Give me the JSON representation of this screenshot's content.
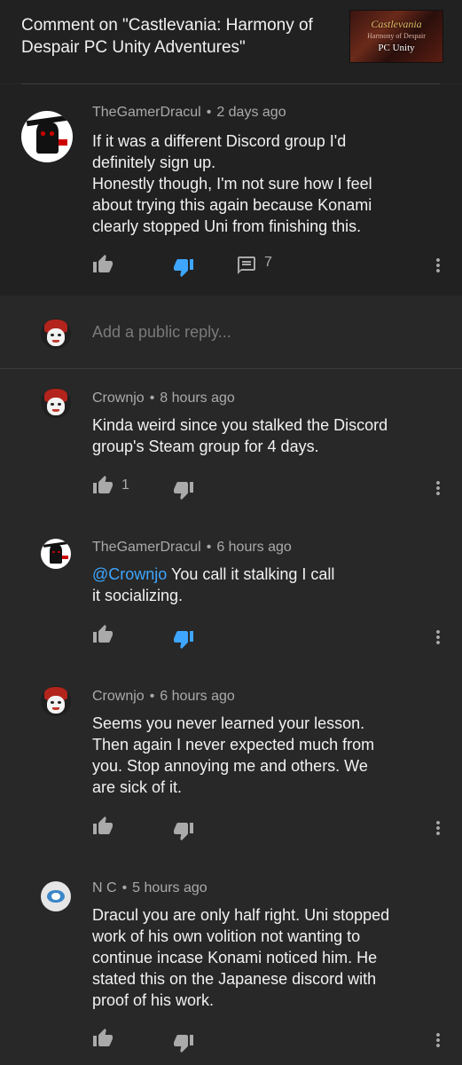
{
  "header": {
    "title": "Comment on \"Castlevania: Harmony of Despair PC Unity Adventures\"",
    "thumbnail": {
      "line1": "Castlevania",
      "line2": "Harmony of Despair",
      "line3": "PC Unity"
    }
  },
  "main_comment": {
    "author": "TheGamerDracul",
    "time": "2 days ago",
    "lines": [
      "If it was a different Discord group I'd",
      "definitely sign up.",
      "Honestly though, I'm not sure how I feel",
      "about trying this again because Konami",
      "clearly stopped Uni from finishing this."
    ],
    "reply_count": "7",
    "disliked": true
  },
  "reply_input": {
    "placeholder": "Add a public reply..."
  },
  "replies": [
    {
      "author": "Crownjo",
      "time": "8 hours ago",
      "lines": [
        "Kinda weird since you stalked the Discord",
        "group's Steam group for 4 days."
      ],
      "likes": "1"
    },
    {
      "author": "TheGamerDracul",
      "time": "6 hours ago",
      "mention": "@Crownjo",
      "lines": [
        " You call it stalking I call",
        "it socializing."
      ],
      "disliked": true
    },
    {
      "author": "Crownjo",
      "time": "6 hours ago",
      "lines": [
        "Seems you never learned your lesson.",
        "Then again I never expected much from",
        "you. Stop annoying me and others. We",
        "are sick of it."
      ]
    },
    {
      "author": "N C",
      "time": "5 hours ago",
      "lines": [
        "Dracul you are only half right. Uni stopped",
        "work of his own volition not wanting to",
        "continue incase Konami noticed him. He",
        "stated this on the Japanese discord with",
        "proof of his work."
      ]
    }
  ],
  "separator": "•",
  "colors": {
    "background": "#282828",
    "highlight_background": "#212121",
    "text": "#f1f1f1",
    "secondary_text": "#aaaaaa",
    "accent_blue": "#3ea6ff"
  },
  "icons": [
    "thumb-up-icon",
    "thumb-down-icon",
    "comment-icon",
    "more-vert-icon"
  ]
}
